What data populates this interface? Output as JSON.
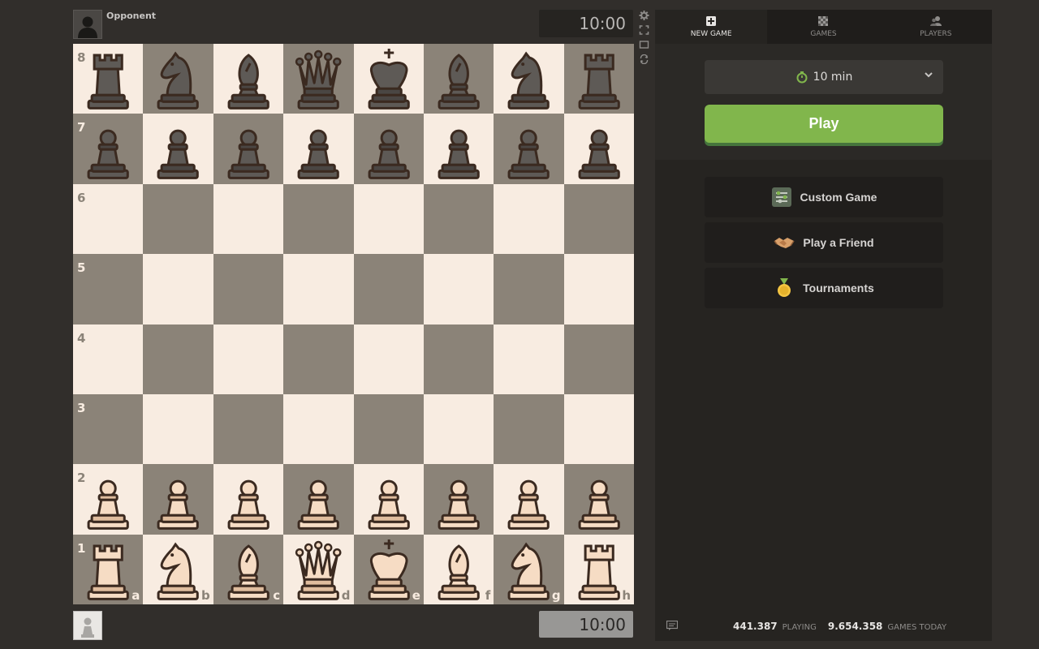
{
  "opponent": {
    "name": "Opponent",
    "clock": "10:00"
  },
  "player": {
    "clock": "10:00"
  },
  "board": {
    "ranks": [
      "8",
      "7",
      "6",
      "5",
      "4",
      "3",
      "2",
      "1"
    ],
    "files": [
      "a",
      "b",
      "c",
      "d",
      "e",
      "f",
      "g",
      "h"
    ],
    "position": [
      [
        "bR",
        "bN",
        "bB",
        "bQ",
        "bK",
        "bB",
        "bN",
        "bR"
      ],
      [
        "bP",
        "bP",
        "bP",
        "bP",
        "bP",
        "bP",
        "bP",
        "bP"
      ],
      [
        "",
        "",
        "",
        "",
        "",
        "",
        "",
        ""
      ],
      [
        "",
        "",
        "",
        "",
        "",
        "",
        "",
        ""
      ],
      [
        "",
        "",
        "",
        "",
        "",
        "",
        "",
        ""
      ],
      [
        "",
        "",
        "",
        "",
        "",
        "",
        "",
        ""
      ],
      [
        "wP",
        "wP",
        "wP",
        "wP",
        "wP",
        "wP",
        "wP",
        "wP"
      ],
      [
        "wR",
        "wN",
        "wB",
        "wQ",
        "wK",
        "wB",
        "wN",
        "wR"
      ]
    ]
  },
  "side_icons": [
    "gear-icon",
    "fullscreen-icon",
    "board-theme-icon",
    "flip-board-icon"
  ],
  "tabs": [
    {
      "label": "NEW GAME",
      "icon": "plus-square-icon",
      "active": true
    },
    {
      "label": "GAMES",
      "icon": "checkerboard-icon",
      "active": false
    },
    {
      "label": "PLAYERS",
      "icon": "players-icon",
      "active": false
    }
  ],
  "time_control": {
    "value": "10 min"
  },
  "play_button": {
    "label": "Play"
  },
  "options": [
    {
      "label": "Custom Game",
      "icon": "sliders-icon"
    },
    {
      "label": "Play a Friend",
      "icon": "handshake-icon"
    },
    {
      "label": "Tournaments",
      "icon": "medal-icon"
    }
  ],
  "footer": {
    "playing_count": "441.387",
    "playing_label": "PLAYING",
    "games_today_count": "9.654.358",
    "games_today_label": "GAMES TODAY"
  },
  "colors": {
    "accent": "#81b64c",
    "light_square": "#f8ece1",
    "dark_square": "#8b8378",
    "background": "#312e2b"
  }
}
